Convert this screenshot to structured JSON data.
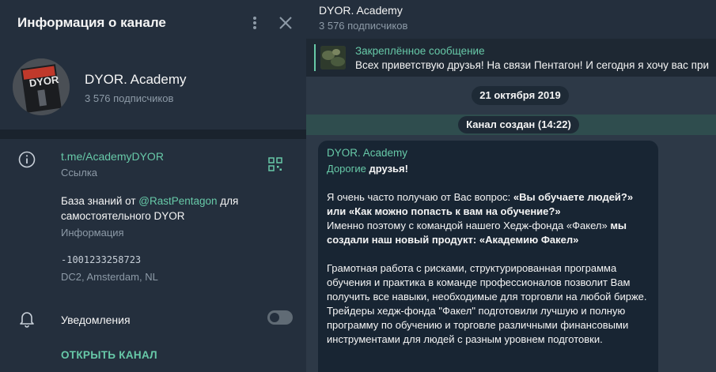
{
  "info": {
    "title": "Информация о канале",
    "channel_name": "DYOR. Academy",
    "subscribers": "3 576 подписчиков",
    "avatar_text": "DYOR",
    "link": "t.me/AcademyDYOR",
    "link_caption": "Ссылка",
    "description_prefix": "База знаний от ",
    "description_mention": "@RastPentagon",
    "description_suffix": " для самостоятельного DYOR",
    "description_caption": "Информация",
    "channel_id": "-1001233258723",
    "dc": "DC2, Amsterdam, NL",
    "notifications_label": "Уведомления",
    "notifications_on": false,
    "open_channel": "ОТКРЫТЬ КАНАЛ"
  },
  "chat": {
    "title": "DYOR. Academy",
    "subscribers": "3 576 подписчиков",
    "pinned_label": "Закреплённое сообщение",
    "pinned_text": "Всех приветствую друзья! На связи Пентагон! И сегодня я хочу вас при",
    "date": "21 октября 2019",
    "created": "Канал создан (14:22)",
    "message": {
      "sender": "DYOR. Academy",
      "greet_green": "Дорогие",
      "greet_rest": " друзья!",
      "p1_a": "Я очень часто получаю от Вас вопрос: ",
      "p1_b": "«Вы обучаете людей?» или «Как можно попасть к вам на обучение?»",
      "p2_a": "Именно поэтому с командой нашего Хедж-фонда «Факел» ",
      "p2_b": "мы создали наш новый продукт:  «Академию Факел»",
      "p3": "Грамотная работа с рисками, структурированная программа обучения и практика в команде профессионалов позволит Вам получить все навыки, необходимые для торговли на любой бирже.",
      "p4": "Трейдеры хедж-фонда \"Факел\" подготовили лучшую и полную программу по обучению и торговле различными финансовыми инструментами для людей с разным уровнем подготовки."
    }
  },
  "colors": {
    "accent": "#67c9a8",
    "panel": "#242f3d",
    "chat_bg": "#2d3947",
    "bubble": "#182533"
  }
}
